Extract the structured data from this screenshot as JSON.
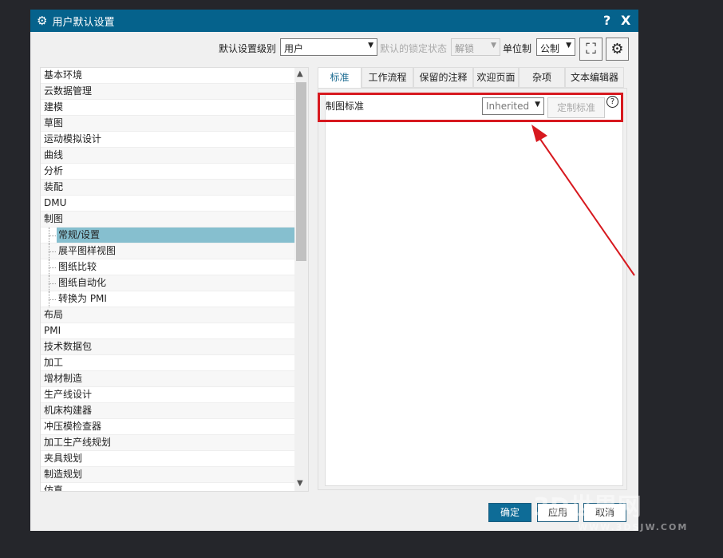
{
  "window": {
    "title": "用户默认设置",
    "help": "?",
    "close": "X"
  },
  "toolbar": {
    "level_label": "默认设置级别",
    "level_value": "用户",
    "lock_label": "默认的锁定状态",
    "lock_value": "解锁",
    "unit_label": "单位制",
    "unit_value": "公制"
  },
  "tree": {
    "items": [
      {
        "label": "基本环境",
        "child": false
      },
      {
        "label": "云数据管理",
        "child": false
      },
      {
        "label": "建模",
        "child": false
      },
      {
        "label": "草图",
        "child": false
      },
      {
        "label": "运动模拟设计",
        "child": false
      },
      {
        "label": "曲线",
        "child": false
      },
      {
        "label": "分析",
        "child": false
      },
      {
        "label": "装配",
        "child": false
      },
      {
        "label": "DMU",
        "child": false
      },
      {
        "label": "制图",
        "child": false
      },
      {
        "label": "常规/设置",
        "child": true,
        "selected": true
      },
      {
        "label": "展平图样视图",
        "child": true
      },
      {
        "label": "图纸比较",
        "child": true
      },
      {
        "label": "图纸自动化",
        "child": true
      },
      {
        "label": "转换为 PMI",
        "child": true
      },
      {
        "label": "布局",
        "child": false
      },
      {
        "label": "PMI",
        "child": false
      },
      {
        "label": "技术数据包",
        "child": false
      },
      {
        "label": "加工",
        "child": false
      },
      {
        "label": "增材制造",
        "child": false
      },
      {
        "label": "生产线设计",
        "child": false
      },
      {
        "label": "机床构建器",
        "child": false
      },
      {
        "label": "冲压模检查器",
        "child": false
      },
      {
        "label": "加工生产线规划",
        "child": false
      },
      {
        "label": "夹具规划",
        "child": false
      },
      {
        "label": "制造规划",
        "child": false
      },
      {
        "label": "仿真",
        "child": false
      }
    ]
  },
  "tabs": [
    {
      "label": "标准",
      "active": true
    },
    {
      "label": "工作流程"
    },
    {
      "label": "保留的注释"
    },
    {
      "label": "欢迎页面"
    },
    {
      "label": "杂项"
    },
    {
      "label": "文本编辑器"
    }
  ],
  "setting": {
    "label": "制图标准",
    "value": "Inherited",
    "custom_button": "定制标准",
    "help": "?"
  },
  "buttons": {
    "ok": "确定",
    "apply": "应用",
    "cancel": "取消"
  },
  "watermark": {
    "brand": "3D世界网",
    "url": "WWW.3DSJW.COM"
  },
  "colors": {
    "titlebar": "#05628c",
    "highlight": "#d7191f",
    "selected": "#86bfcf"
  }
}
